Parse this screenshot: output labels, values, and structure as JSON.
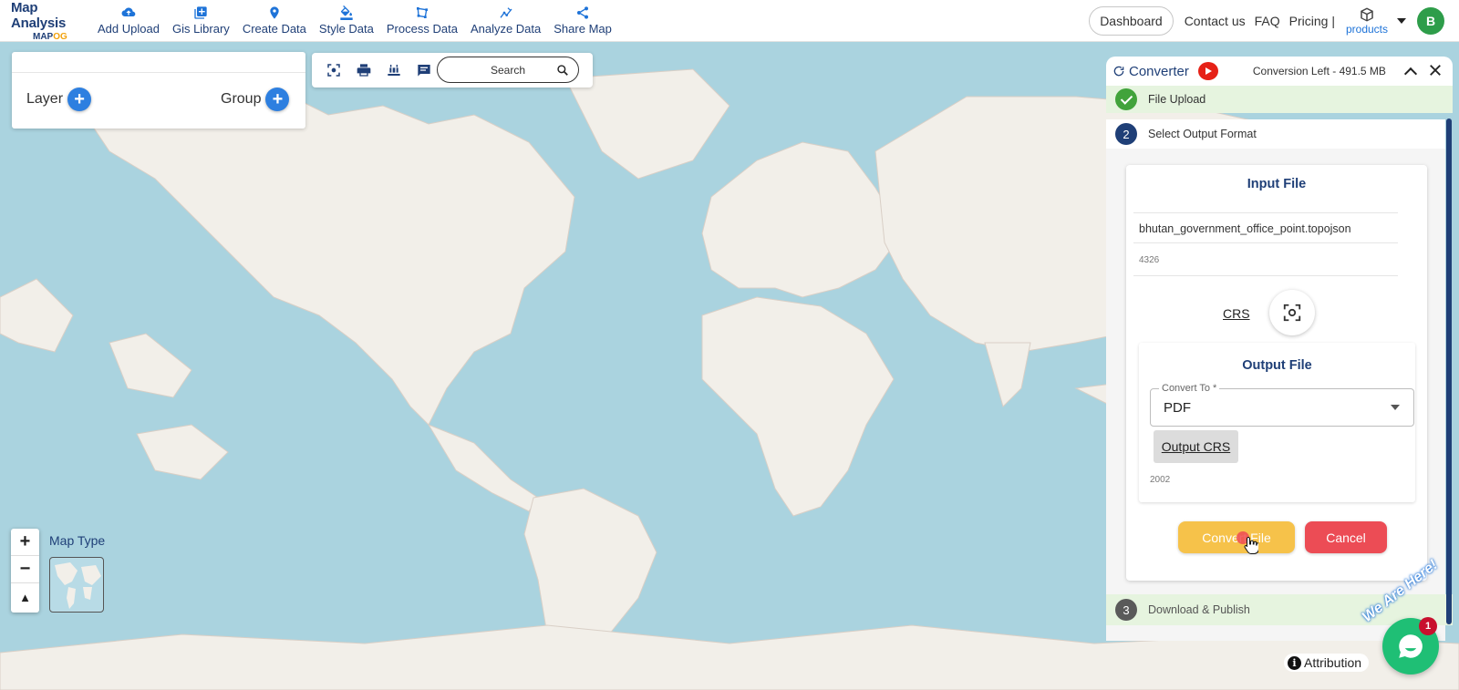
{
  "brand": {
    "title": "Map Analysis",
    "logo_main": "MAP",
    "logo_accent": "OG"
  },
  "nav": [
    {
      "label": "Add Upload",
      "icon": "cloud-upload-icon"
    },
    {
      "label": "Gis Library",
      "icon": "library-add-icon"
    },
    {
      "label": "Create Data",
      "icon": "map-pin-icon"
    },
    {
      "label": "Style Data",
      "icon": "paint-bucket-icon"
    },
    {
      "label": "Process Data",
      "icon": "polygon-edit-icon"
    },
    {
      "label": "Analyze Data",
      "icon": "analyze-icon"
    },
    {
      "label": "Share Map",
      "icon": "share-icon"
    }
  ],
  "header_right": {
    "dashboard": "Dashboard",
    "contact": "Contact us",
    "faq": "FAQ",
    "pricing": "Pricing |",
    "products": "products",
    "avatar_initial": "B"
  },
  "layer_panel": {
    "layer_label": "Layer",
    "group_label": "Group"
  },
  "toolbar": {
    "search_label": "Search"
  },
  "map_controls": {
    "zoom_in": "+",
    "zoom_out": "−",
    "reset": "▲",
    "map_type_label": "Map Type"
  },
  "attribution": "Attribution",
  "converter": {
    "title": "Converter",
    "conversion_left": "Conversion Left - 491.5 MB",
    "step1_label": "File Upload",
    "step2_number": "2",
    "step2_label": "Select Output Format",
    "input_title": "Input File",
    "input_filename": "bhutan_government_office_point.topojson",
    "input_epsg": "4326",
    "crs_label": "CRS",
    "output_title": "Output File",
    "convert_to_label": "Convert To *",
    "convert_to_value": "PDF",
    "output_crs_label": "Output CRS",
    "output_epsg": "2002",
    "convert_button": "Convert File",
    "cancel_button": "Cancel",
    "step3_number": "3",
    "step3_label": "Download & Publish"
  },
  "chat": {
    "badge": "1",
    "banner": "We Are Here!"
  },
  "colors": {
    "brand_navy": "#1f3f77",
    "ocean": "#aad3df",
    "land": "#f2efe9",
    "convert": "#f6c24a",
    "cancel": "#ec4c55",
    "success": "#41a33b",
    "chat": "#1fbf75"
  }
}
